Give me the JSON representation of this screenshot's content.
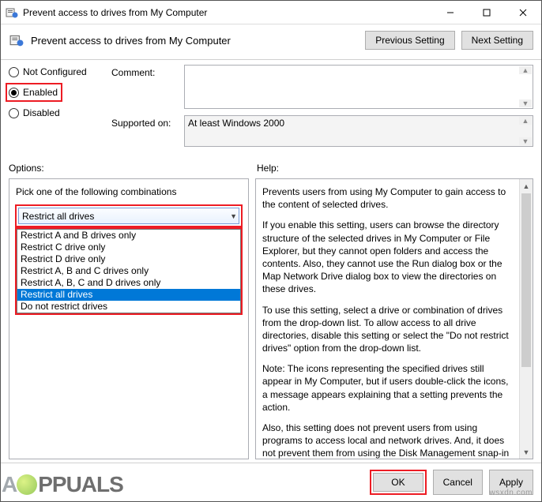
{
  "titlebar": {
    "title": "Prevent access to drives from My Computer"
  },
  "header": {
    "title": "Prevent access to drives from My Computer",
    "prev": "Previous Setting",
    "next": "Next Setting"
  },
  "radios": {
    "not_configured": "Not Configured",
    "enabled": "Enabled",
    "disabled": "Disabled"
  },
  "fields": {
    "comment_label": "Comment:",
    "supported_label": "Supported on:",
    "supported_value": "At least Windows 2000"
  },
  "labels": {
    "options": "Options:",
    "help": "Help:"
  },
  "options": {
    "prompt": "Pick one of the following combinations",
    "selected": "Restrict all drives",
    "list": [
      "Restrict A and B drives only",
      "Restrict C drive only",
      "Restrict D drive only",
      "Restrict A, B and C drives only",
      "Restrict A, B, C and D drives only",
      "Restrict all drives",
      "Do not restrict drives"
    ]
  },
  "help": {
    "p1": "Prevents users from using My Computer to gain access to the content of selected drives.",
    "p2": "If you enable this setting, users can browse the directory structure of the selected drives in My Computer or File Explorer, but they cannot open folders and access the contents. Also, they cannot use the Run dialog box or the Map Network Drive dialog box to view the directories on these drives.",
    "p3": "To use this setting, select a drive or combination of drives from the drop-down list. To allow access to all drive directories, disable this setting or select the \"Do not restrict drives\" option from the drop-down list.",
    "p4": "Note: The icons representing the specified drives still appear in My Computer, but if users double-click the icons, a message appears explaining that a setting prevents the action.",
    "p5": " Also, this setting does not prevent users from using programs to access local and network drives. And, it does not prevent them from using the Disk Management snap-in to view and change"
  },
  "footer": {
    "ok": "OK",
    "cancel": "Cancel",
    "apply": "Apply"
  },
  "watermark": "wsxdn.com",
  "logo_text": "PPUALS"
}
